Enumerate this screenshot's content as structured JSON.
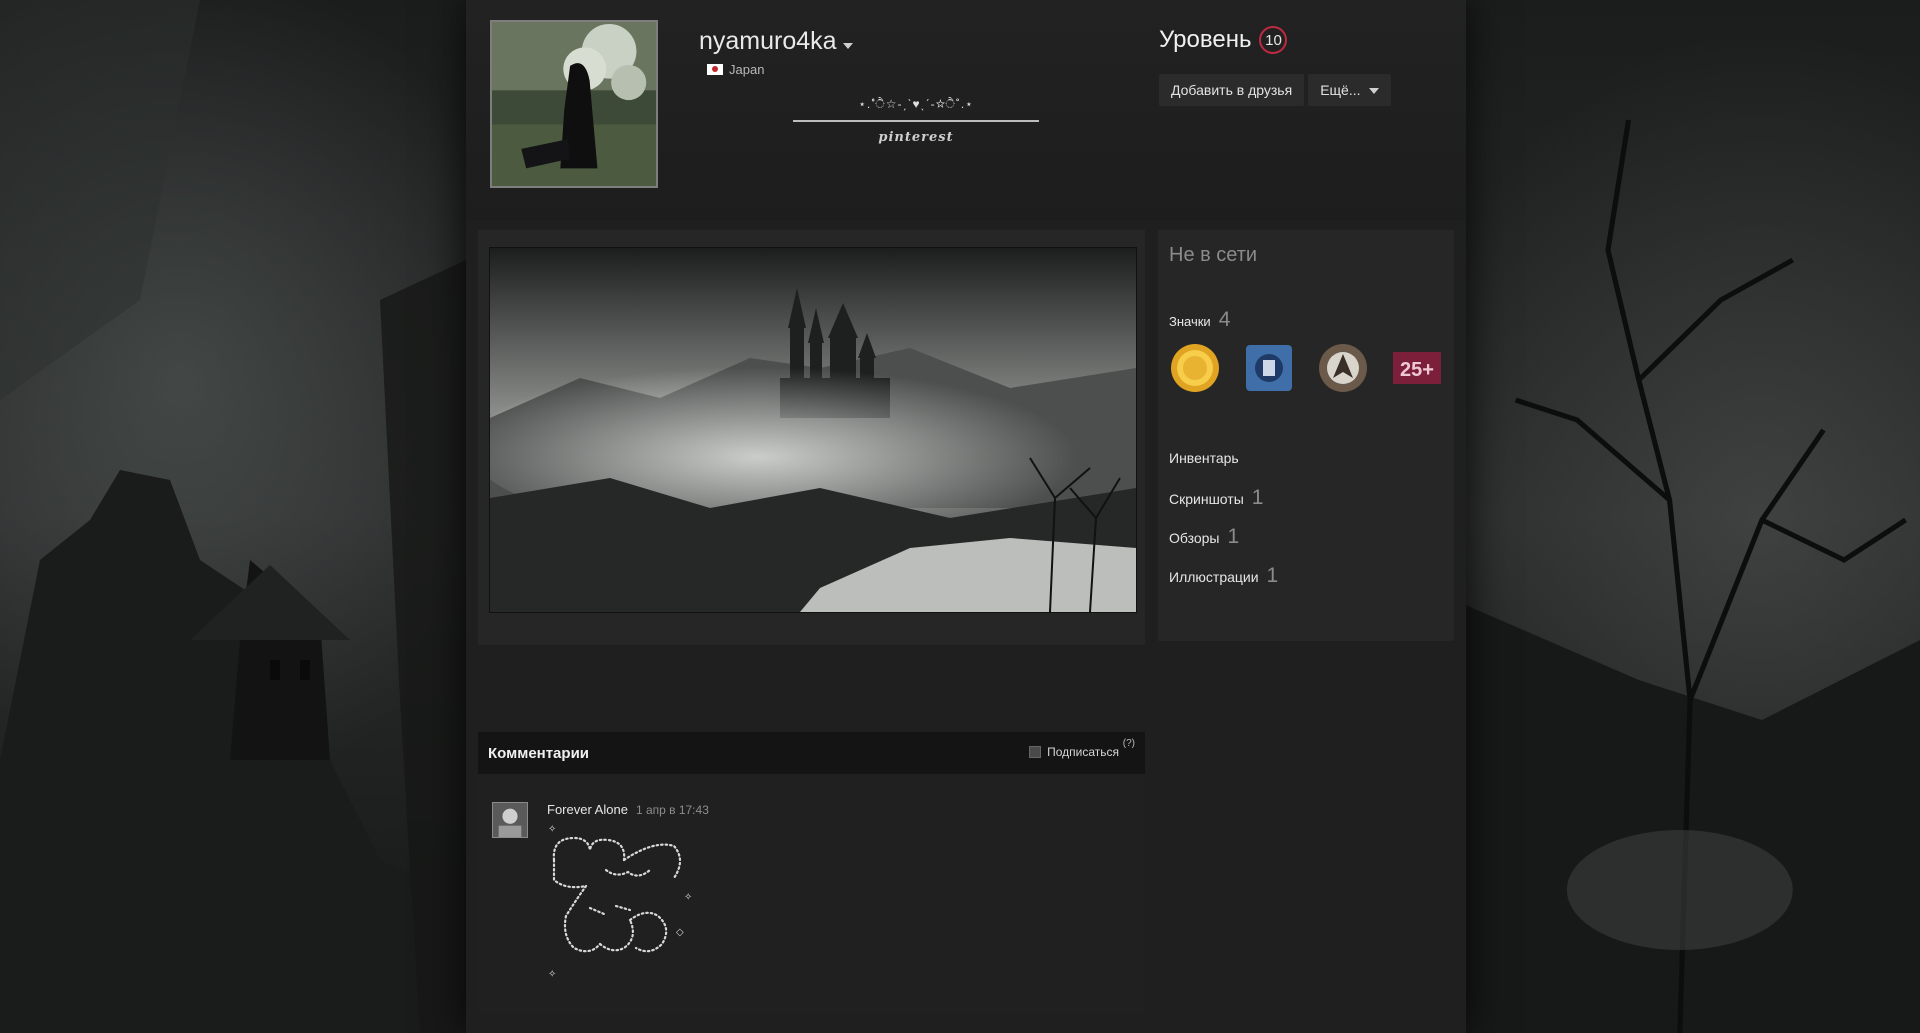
{
  "profile": {
    "persona_name": "nyamuro4ka",
    "location": "Japan",
    "summary_decoration": "⋆.˚ੈ☆-ˏˋ♥ˎˊ-☆ੈ˚.⋆",
    "summary_link": "pinterest"
  },
  "level": {
    "label": "Уровень",
    "value": "10"
  },
  "actions": {
    "add_friend": "Добавить в друзья",
    "more": "Ещё..."
  },
  "sidebar": {
    "status": "Не в сети",
    "badges": {
      "label": "Значки",
      "count": "4",
      "last_badge_text": "25+"
    },
    "items": [
      {
        "label": "Инвентарь",
        "count": ""
      },
      {
        "label": "Скриншоты",
        "count": "1"
      },
      {
        "label": "Обзоры",
        "count": "1"
      },
      {
        "label": "Иллюстрации",
        "count": "1"
      }
    ]
  },
  "comments": {
    "title": "Комментарии",
    "subscribe": "Подписаться",
    "help": "(?)",
    "items": [
      {
        "author": "Forever Alone",
        "time": "1 апр в 17:43"
      }
    ]
  },
  "colors": {
    "level_ring": "#c02942",
    "page_bg": "#1f1f1f",
    "panel_bg": "#262626"
  },
  "icons": [
    "chevron-down-icon",
    "japan-flag-icon",
    "badge-coin-icon",
    "badge-shield-icon",
    "badge-emblem-icon",
    "badge-years-icon",
    "checkbox-icon"
  ]
}
